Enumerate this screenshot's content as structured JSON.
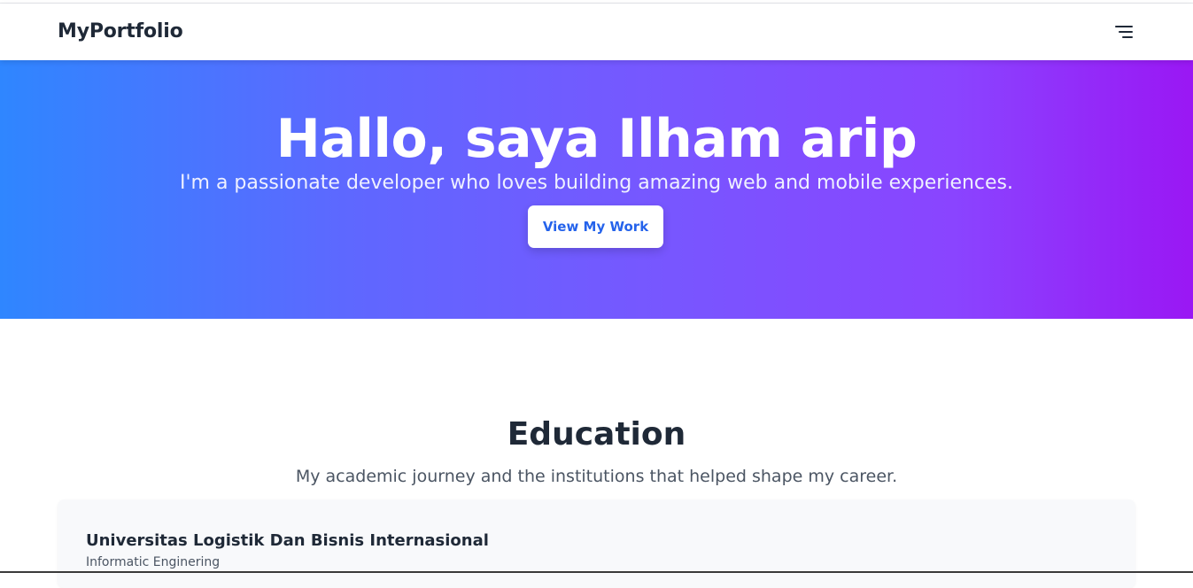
{
  "navbar": {
    "brand": "MyPortfolio",
    "menu_icon": "hamburger-menu-icon"
  },
  "hero": {
    "title": "Hallo, saya Ilham arip",
    "subtitle": "I'm a passionate developer who loves building amazing web and mobile experiences.",
    "cta_label": "View My Work",
    "gradient_start": "#2f86ff",
    "gradient_end": "#9a17f4"
  },
  "education": {
    "title": "Education",
    "subtitle": "My academic journey and the institutions that helped shape my career.",
    "items": [
      {
        "school": "Universitas Logistik Dan Bisnis Internasional",
        "major": "Informatic Enginering"
      }
    ]
  },
  "colors": {
    "accent": "#2563eb",
    "text": "#1f2937",
    "muted": "#4b5563",
    "card_bg": "#f8f9fb"
  }
}
